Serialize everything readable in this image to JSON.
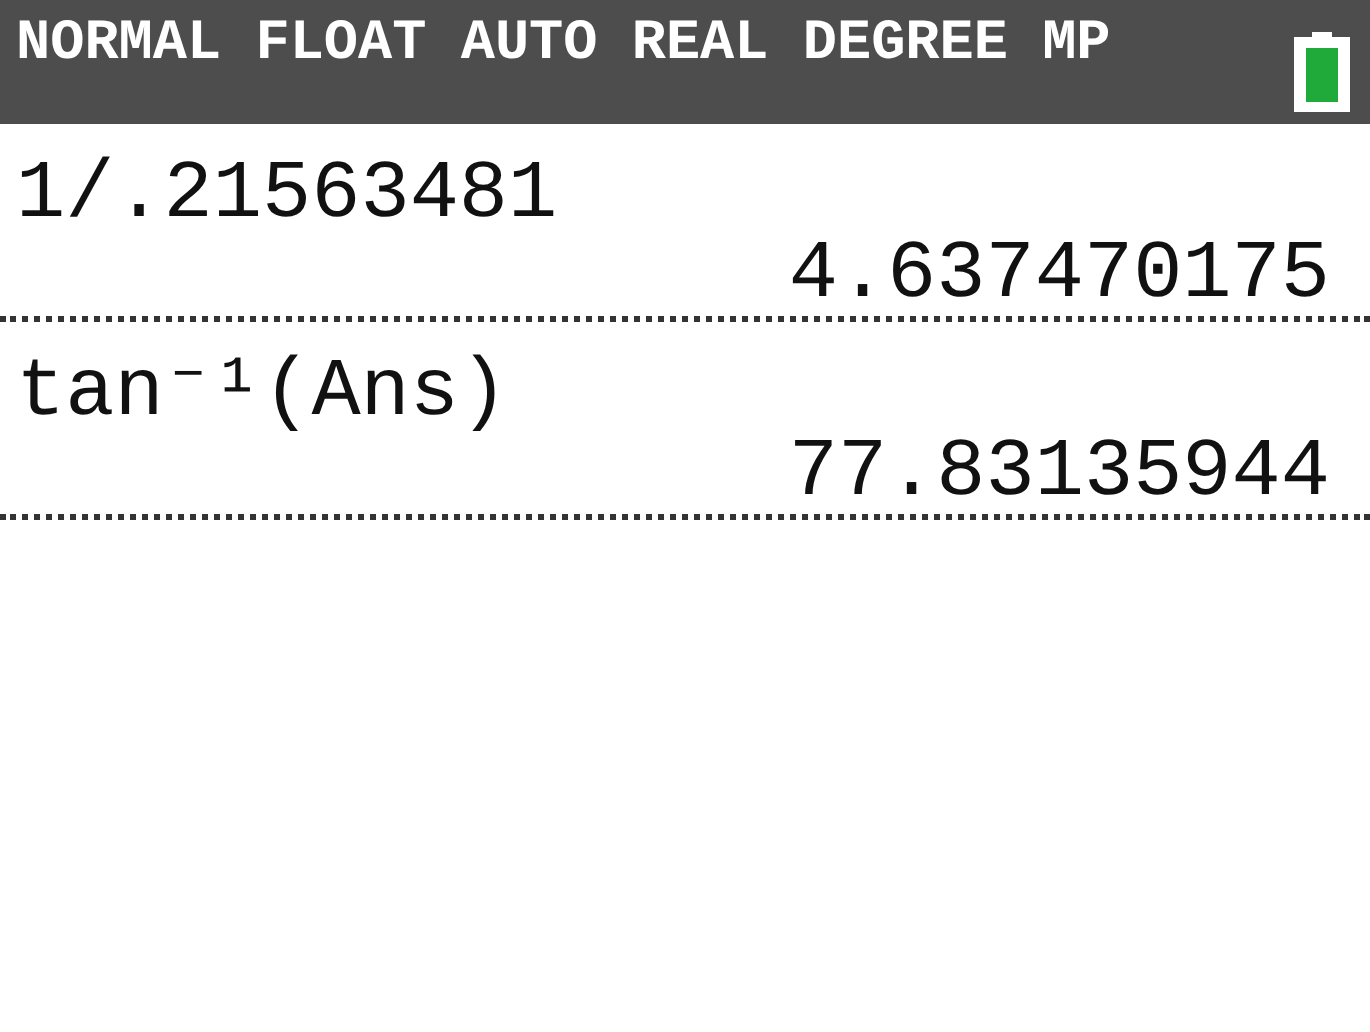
{
  "status_bar": {
    "modes": "NORMAL FLOAT AUTO REAL DEGREE MP"
  },
  "history": [
    {
      "expression": "1/.21563481",
      "result": "4.637470175"
    },
    {
      "expression": "tan⁻¹(Ans)",
      "result": "77.83135944"
    }
  ]
}
